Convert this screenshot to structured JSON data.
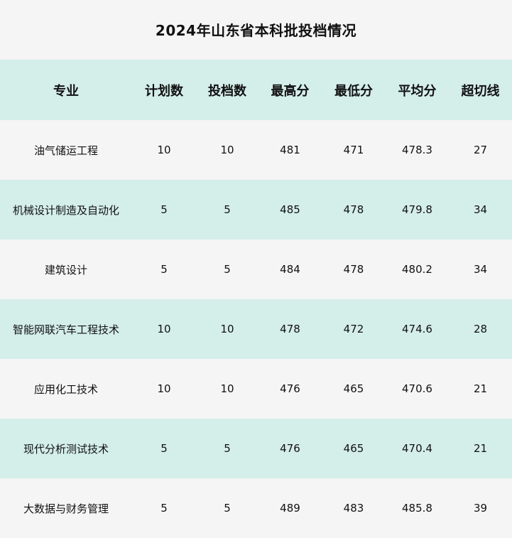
{
  "title": "2024年山东省本科批投档情况",
  "headers": [
    "专业",
    "计划数",
    "投档数",
    "最高分",
    "最低分",
    "平均分",
    "超切线"
  ],
  "rows": [
    [
      "油气储运工程",
      "10",
      "10",
      "481",
      "471",
      "478.3",
      "27"
    ],
    [
      "机械设计制造及自动化",
      "5",
      "5",
      "485",
      "478",
      "479.8",
      "34"
    ],
    [
      "建筑设计",
      "5",
      "5",
      "484",
      "478",
      "480.2",
      "34"
    ],
    [
      "智能网联汽车工程技术",
      "10",
      "10",
      "478",
      "472",
      "474.6",
      "28"
    ],
    [
      "应用化工技术",
      "10",
      "10",
      "476",
      "465",
      "470.6",
      "21"
    ],
    [
      "现代分析测试技术",
      "5",
      "5",
      "476",
      "465",
      "470.4",
      "21"
    ],
    [
      "大数据与财务管理",
      "5",
      "5",
      "489",
      "483",
      "485.8",
      "39"
    ]
  ],
  "colors": {
    "header_bg": "#d4eeea",
    "row_light": "#f5f5f5",
    "row_tint": "#d4eeea"
  }
}
